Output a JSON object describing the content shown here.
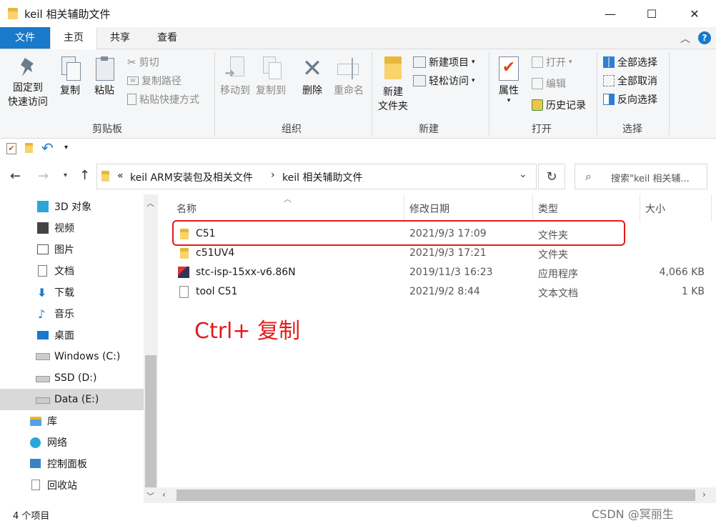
{
  "window": {
    "title": "keil 相关辅助文件",
    "minimize": "—",
    "maximize": "☐",
    "close": "✕"
  },
  "ribbon_tabs": [
    "文件",
    "主页",
    "共享",
    "查看"
  ],
  "ribbon": {
    "clipboard": {
      "pin": "固定到\n快速访问",
      "copy": "复制",
      "paste": "粘贴",
      "cut": "剪切",
      "copy_path": "复制路径",
      "paste_shortcut": "粘贴快捷方式",
      "label": "剪贴板"
    },
    "organize": {
      "move_to": "移动到",
      "copy_to": "复制到",
      "delete": "删除",
      "rename": "重命名",
      "label": "组织"
    },
    "new": {
      "new_folder": "新建\n文件夹",
      "new_item": "新建项目",
      "easy_access": "轻松访问",
      "label": "新建"
    },
    "open": {
      "properties": "属性",
      "open": "打开",
      "edit": "编辑",
      "history": "历史记录",
      "label": "打开"
    },
    "select": {
      "select_all": "全部选择",
      "select_none": "全部取消",
      "invert": "反向选择",
      "label": "选择"
    }
  },
  "address": {
    "prefix": "«",
    "crumb1": "keil ARM安装包及相关文件",
    "sep": "›",
    "crumb2": "keil 相关辅助文件",
    "search_placeholder": "搜索\"keil 相关辅..."
  },
  "nav_items": [
    {
      "label": "3D 对象",
      "icon": "3d-objects-icon"
    },
    {
      "label": "视频",
      "icon": "video-icon"
    },
    {
      "label": "图片",
      "icon": "pictures-icon"
    },
    {
      "label": "文档",
      "icon": "documents-icon"
    },
    {
      "label": "下载",
      "icon": "downloads-icon"
    },
    {
      "label": "音乐",
      "icon": "music-icon"
    },
    {
      "label": "桌面",
      "icon": "desktop-icon"
    },
    {
      "label": "Windows (C:)",
      "icon": "drive-c-icon"
    },
    {
      "label": "SSD (D:)",
      "icon": "drive-icon"
    },
    {
      "label": "Data (E:)",
      "icon": "drive-icon"
    },
    {
      "label": "库",
      "icon": "library-icon"
    },
    {
      "label": "网络",
      "icon": "network-icon"
    },
    {
      "label": "控制面板",
      "icon": "control-panel-icon"
    },
    {
      "label": "回收站",
      "icon": "recycle-bin-icon"
    }
  ],
  "columns": [
    "名称",
    "修改日期",
    "类型",
    "大小"
  ],
  "files": [
    {
      "name": "C51",
      "date": "2021/9/3 17:09",
      "type": "文件夹",
      "size": ""
    },
    {
      "name": "c51UV4",
      "date": "2021/9/3 17:21",
      "type": "文件夹",
      "size": ""
    },
    {
      "name": "stc-isp-15xx-v6.86N",
      "date": "2019/11/3 16:23",
      "type": "应用程序",
      "size": "4,066 KB"
    },
    {
      "name": "tool C51",
      "date": "2021/9/2 8:44",
      "type": "文本文档",
      "size": "1 KB"
    }
  ],
  "annotation": "Ctrl+  复制",
  "status": "4 个项目",
  "watermark": "CSDN @冥丽生"
}
